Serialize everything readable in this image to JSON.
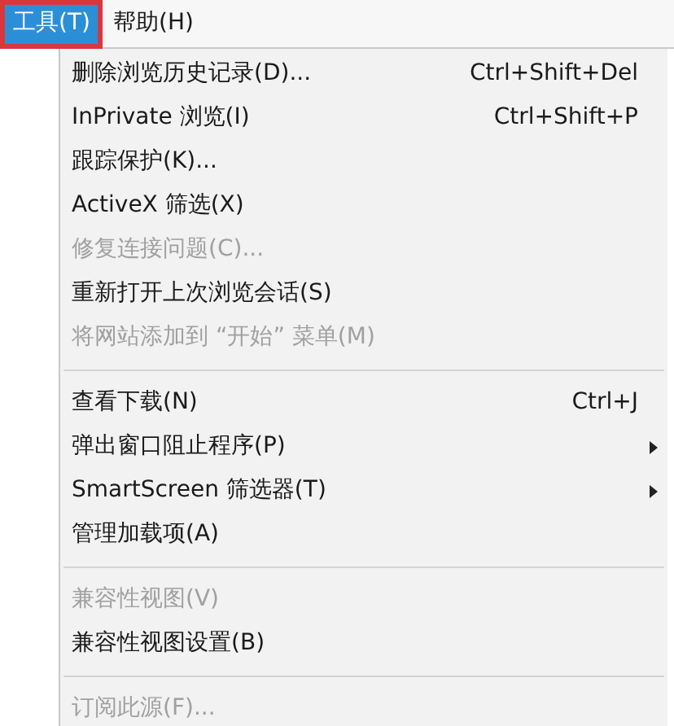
{
  "menu_bar": [
    {
      "label": "工具(T)",
      "selected": true
    },
    {
      "label": "帮助(H)",
      "selected": false
    }
  ],
  "menu": [
    {
      "kind": "item",
      "label": "删除浏览历史记录(D)...",
      "shortcut": "Ctrl+Shift+Del",
      "disabled": false,
      "submenu": false
    },
    {
      "kind": "item",
      "label": "InPrivate 浏览(I)",
      "shortcut": "Ctrl+Shift+P",
      "disabled": false,
      "submenu": false
    },
    {
      "kind": "item",
      "label": "跟踪保护(K)...",
      "disabled": false,
      "submenu": false
    },
    {
      "kind": "item",
      "label": "ActiveX 筛选(X)",
      "disabled": false,
      "submenu": false
    },
    {
      "kind": "item",
      "label": "修复连接问题(C)...",
      "disabled": true,
      "submenu": false
    },
    {
      "kind": "item",
      "label": "重新打开上次浏览会话(S)",
      "disabled": false,
      "submenu": false
    },
    {
      "kind": "item",
      "label": "将网站添加到 “开始” 菜单(M)",
      "disabled": true,
      "submenu": false
    },
    {
      "kind": "separator"
    },
    {
      "kind": "item",
      "label": "查看下载(N)",
      "shortcut": "Ctrl+J",
      "disabled": false,
      "submenu": false
    },
    {
      "kind": "item",
      "label": "弹出窗口阻止程序(P)",
      "disabled": false,
      "submenu": true
    },
    {
      "kind": "item",
      "label": "SmartScreen 筛选器(T)",
      "disabled": false,
      "submenu": true
    },
    {
      "kind": "item",
      "label": "管理加载项(A)",
      "disabled": false,
      "submenu": false
    },
    {
      "kind": "separator"
    },
    {
      "kind": "item",
      "label": "兼容性视图(V)",
      "disabled": true,
      "submenu": false
    },
    {
      "kind": "item",
      "label": "兼容性视图设置(B)",
      "disabled": false,
      "submenu": false
    },
    {
      "kind": "separator"
    },
    {
      "kind": "item",
      "label": "订阅此源(F)...",
      "disabled": true,
      "submenu": false
    }
  ]
}
